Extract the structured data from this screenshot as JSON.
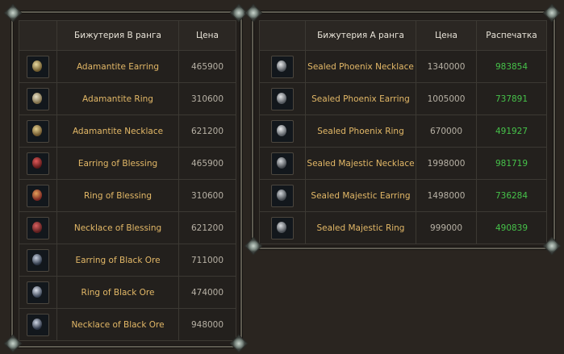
{
  "b_table": {
    "headers": {
      "col1": "",
      "name": "Бижутерия B ранга",
      "price": "Цена"
    },
    "rows": [
      {
        "icon": "adamantite-earring-icon",
        "name": "Adamantite Earring",
        "price": "465900",
        "c1": "#e8d9a0",
        "c2": "#6f5a2c"
      },
      {
        "icon": "adamantite-ring-icon",
        "name": "Adamantite Ring",
        "price": "310600",
        "c1": "#e8e2c8",
        "c2": "#7a6a45"
      },
      {
        "icon": "adamantite-necklace-icon",
        "name": "Adamantite Necklace",
        "price": "621200",
        "c1": "#e3cf8e",
        "c2": "#6b532b"
      },
      {
        "icon": "earring-of-blessing-icon",
        "name": "Earring of Blessing",
        "price": "465900",
        "c1": "#e05a5a",
        "c2": "#5e1818"
      },
      {
        "icon": "ring-of-blessing-icon",
        "name": "Ring of Blessing",
        "price": "310600",
        "c1": "#e4a05a",
        "c2": "#7a2420"
      },
      {
        "icon": "necklace-of-blessing-icon",
        "name": "Necklace of Blessing",
        "price": "621200",
        "c1": "#d86060",
        "c2": "#5a1c1c"
      },
      {
        "icon": "earring-of-black-ore-icon",
        "name": "Earring of Black Ore",
        "price": "711000",
        "c1": "#c7d0e0",
        "c2": "#2c3646"
      },
      {
        "icon": "ring-of-black-ore-icon",
        "name": "Ring of Black Ore",
        "price": "474000",
        "c1": "#dde3ee",
        "c2": "#3b4556"
      },
      {
        "icon": "necklace-of-black-ore-icon",
        "name": "Necklace of Black Ore",
        "price": "948000",
        "c1": "#cfd6e4",
        "c2": "#2a3242"
      }
    ]
  },
  "a_table": {
    "headers": {
      "col1": "",
      "name": "Бижутерия A ранга",
      "price": "Цена",
      "print": "Распечатка"
    },
    "rows": [
      {
        "icon": "sealed-phoenix-necklace-icon",
        "name": "Sealed Phoenix Necklace",
        "price": "1340000",
        "print": "983854",
        "c1": "#e6e8ea",
        "c2": "#4d5258"
      },
      {
        "icon": "sealed-phoenix-earring-icon",
        "name": "Sealed Phoenix Earring",
        "price": "1005000",
        "print": "737891",
        "c1": "#e2e4e6",
        "c2": "#50555b"
      },
      {
        "icon": "sealed-phoenix-ring-icon",
        "name": "Sealed Phoenix Ring",
        "price": "670000",
        "print": "491927",
        "c1": "#eceeef",
        "c2": "#555a60"
      },
      {
        "icon": "sealed-majestic-necklace-icon",
        "name": "Sealed Majestic Necklace",
        "price": "1998000",
        "print": "981719",
        "c1": "#d6d9dc",
        "c2": "#43474c"
      },
      {
        "icon": "sealed-majestic-earring-icon",
        "name": "Sealed Majestic Earring",
        "price": "1498000",
        "print": "736284",
        "c1": "#d2d6da",
        "c2": "#41464b"
      },
      {
        "icon": "sealed-majestic-ring-icon",
        "name": "Sealed Majestic Ring",
        "price": "999000",
        "print": "490839",
        "c1": "#dcdfe2",
        "c2": "#474c52"
      }
    ]
  },
  "colors": {
    "name_text": "#e3b867",
    "print_text": "#46c24a",
    "price_text": "#b7b1a5",
    "header_text": "#e8e3d8"
  }
}
